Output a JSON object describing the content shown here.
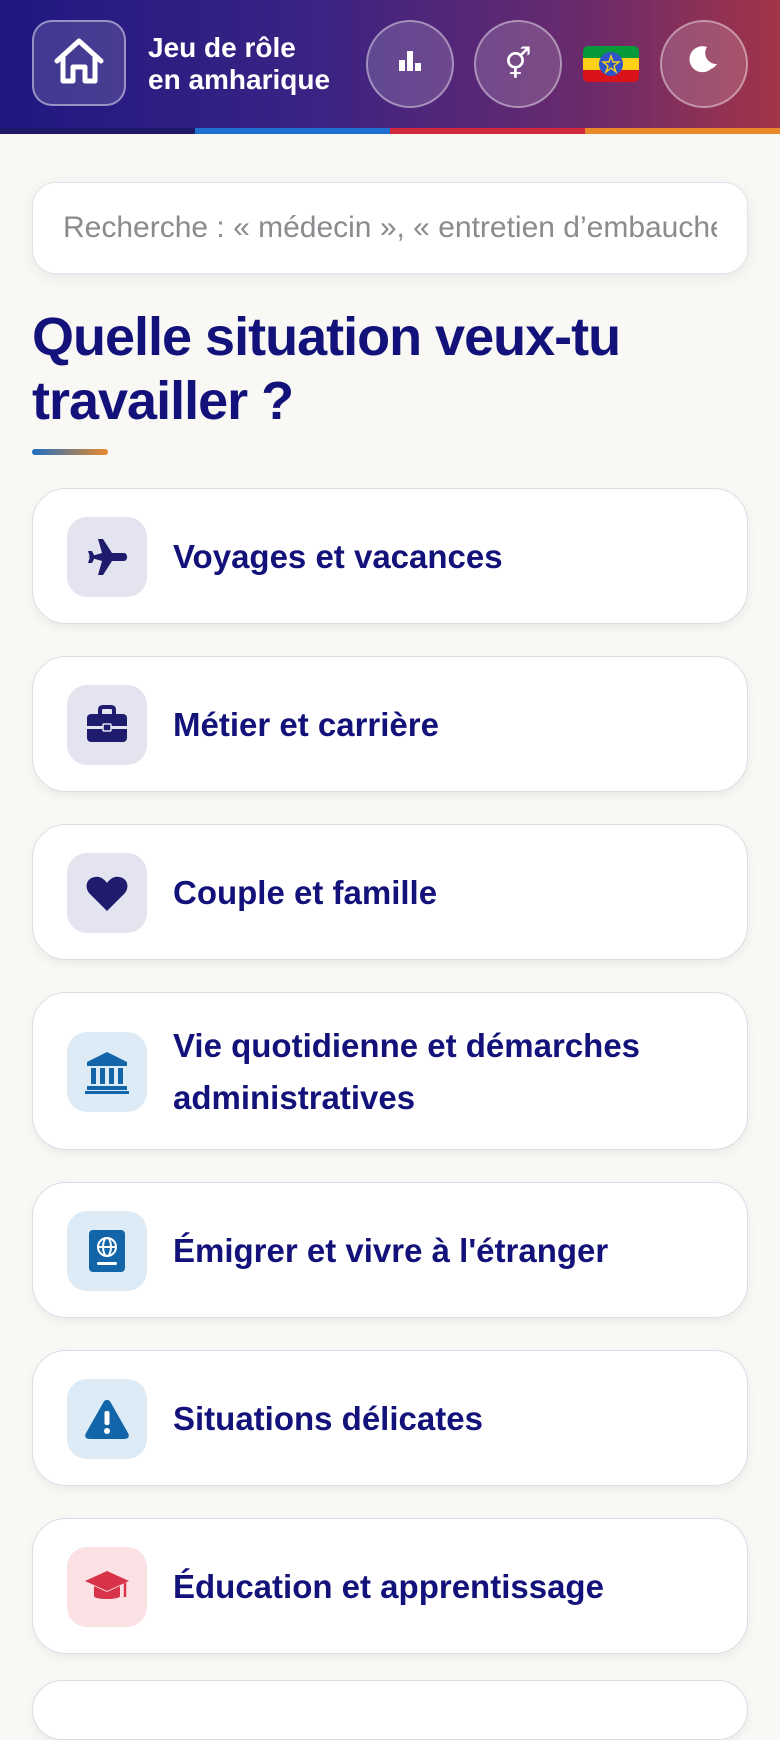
{
  "header": {
    "title_line1": "Jeu de rôle",
    "title_line2": "en amharique",
    "gender_symbol": "⚥",
    "icons": [
      "home-icon",
      "bar-chart-icon",
      "gender-icon",
      "ethiopia-flag",
      "moon-icon"
    ],
    "stripe_colors": [
      "#1e1a66",
      "#1f6fd0",
      "#d02a3c",
      "#e98a2a"
    ]
  },
  "search": {
    "placeholder": "Recherche : « médecin », « entretien d’embauche »…"
  },
  "main": {
    "heading": "Quelle situation veux-tu travailler ?",
    "categories": [
      {
        "label": "Voyages et vacances",
        "icon": "airplane-icon",
        "tint": "#e4e3f0",
        "color": "#1f1c6e"
      },
      {
        "label": "Métier et carrière",
        "icon": "briefcase-icon",
        "tint": "#e4e3f0",
        "color": "#1f1c6e"
      },
      {
        "label": "Couple et famille",
        "icon": "heart-icon",
        "tint": "#e4e3f0",
        "color": "#1f1c6e"
      },
      {
        "label": "Vie quotidienne et démarches administratives",
        "icon": "bank-icon",
        "tint": "#dcebf6",
        "color": "#1165a8"
      },
      {
        "label": "Émigrer et vivre à l'étranger",
        "icon": "passport-icon",
        "tint": "#dcebf6",
        "color": "#1165a8"
      },
      {
        "label": "Situations délicates",
        "icon": "warning-icon",
        "tint": "#dcebf6",
        "color": "#1165a8"
      },
      {
        "label": "Éducation et apprentissage",
        "icon": "graduation-cap-icon",
        "tint": "#fbe1e4",
        "color": "#d8334a"
      }
    ]
  }
}
